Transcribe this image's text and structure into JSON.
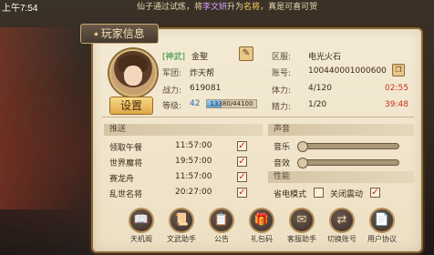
{
  "status_bar": {
    "time": "上午7:54"
  },
  "broadcast": {
    "pre": "仙子通过试炼，将",
    "who": "李文妍",
    "mid": "升为",
    "role": "名将",
    "post": "，真是可喜可贺"
  },
  "panel": {
    "title": "玩家信息",
    "profile": {
      "tag": "[神武]",
      "name": "金聖",
      "settings_label": "设置",
      "rows": [
        {
          "label": "军团:",
          "value": "炸天帮"
        },
        {
          "label": "战力:",
          "value": "619081"
        },
        {
          "label": "等级:",
          "value": "42"
        }
      ],
      "exp": {
        "text": "13380/44100",
        "current": 13380,
        "max": 44100
      }
    },
    "account": [
      {
        "label": "区服:",
        "value": "电光火石"
      },
      {
        "label": "账号:",
        "value": "100440001000600"
      },
      {
        "label": "体力:",
        "value": "4/120",
        "timer": "02:55"
      },
      {
        "label": "精力:",
        "value": "1/20",
        "timer": "39:48"
      }
    ],
    "push": {
      "title": "推送",
      "items": [
        {
          "name": "领取午餐",
          "time": "11:57:00",
          "checked": "✓"
        },
        {
          "name": "世界魔将",
          "time": "19:57:00",
          "checked": "✓"
        },
        {
          "name": "赛龙舟",
          "time": "11:57:00",
          "checked": "✓"
        },
        {
          "name": "乱世名将",
          "time": "20:27:00",
          "checked": "✓"
        }
      ]
    },
    "sound": {
      "title": "声音",
      "music_label": "音乐",
      "sfx_label": "音效",
      "music_level": 0.0,
      "sfx_level": 0.0
    },
    "performance": {
      "title": "性能",
      "power_save_label": "省电模式",
      "power_save_checked": "",
      "disable_shake_label": "关闭震动",
      "disable_shake_checked": "✓"
    },
    "buttons": [
      {
        "label": "天机阁",
        "icon": "book-icon"
      },
      {
        "label": "文武助手",
        "icon": "scroll-icon"
      },
      {
        "label": "公告",
        "icon": "notice-icon"
      },
      {
        "label": "礼包码",
        "icon": "gift-icon"
      },
      {
        "label": "客服助手",
        "icon": "service-icon"
      },
      {
        "label": "切换账号",
        "icon": "switch-icon"
      },
      {
        "label": "用户协议",
        "icon": "agreement-icon"
      }
    ]
  }
}
